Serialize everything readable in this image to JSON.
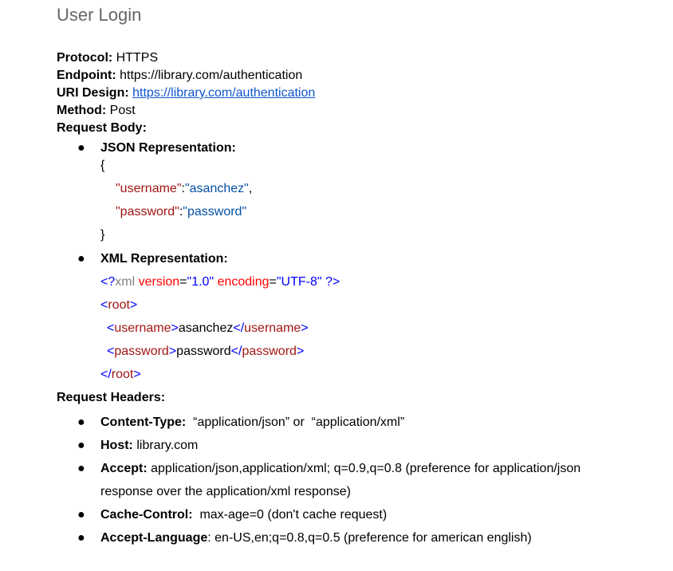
{
  "title": "User Login",
  "protocol": {
    "label": "Protocol:",
    "value": "HTTPS"
  },
  "endpoint": {
    "label": "Endpoint:",
    "value": "https://library.com/authentication"
  },
  "uri_design": {
    "label": "URI Design:",
    "value": "https://library.com/authentication"
  },
  "method": {
    "label": "Method:",
    "value": "Post"
  },
  "request_body": {
    "label": "Request Body:",
    "json": {
      "label": "JSON Representation:",
      "open": "{",
      "username_key": "\"username\"",
      "username_value": "\"asanchez\"",
      "password_key": "\"password\"",
      "password_value": "\"password\"",
      "close": "}"
    },
    "xml": {
      "label": "XML Representation:",
      "decl_open": "<?",
      "decl_name": "xml",
      "decl_version_attr": " version",
      "decl_version_val": "\"1.0\"",
      "decl_encoding_attr": " encoding",
      "decl_encoding_val": "\"UTF-8\"",
      "decl_close": " ?>",
      "root_tag": "root",
      "username_tag": "username",
      "username_value": "asanchez",
      "password_tag": "password",
      "password_value": "password"
    }
  },
  "request_headers": {
    "label": "Request Headers:",
    "items": [
      {
        "name": "Content-Type:",
        "value": "  “application/json” or  “application/xml”"
      },
      {
        "name": "Host:",
        "value": " library.com"
      },
      {
        "name": "Accept:",
        "value": " application/json,application/xml; q=0.9,q=0.8 (preference for application/json",
        "value2": "response over the application/xml response)"
      },
      {
        "name": "Cache-Control:",
        "value": "  max-age=0 (don't cache request)"
      },
      {
        "name": "Accept-Language",
        "value": ": en-US,en;q=0.8,q=0.5 (preference for american english)"
      }
    ]
  }
}
